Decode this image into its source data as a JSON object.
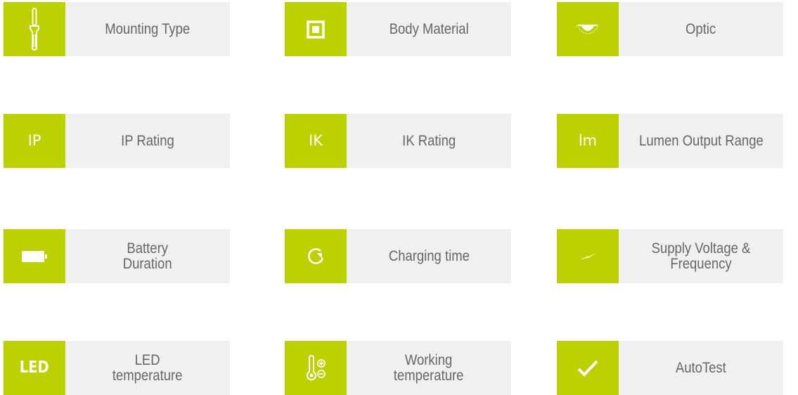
{
  "accent_color": "#bdd000",
  "label_bg_color": "#f0f0f0",
  "label_text_color": "#666666",
  "tiles": [
    {
      "id": "mounting-type",
      "icon": "screwdriver-icon",
      "icon_text": "",
      "label": "Mounting Type"
    },
    {
      "id": "body-material",
      "icon": "square-frame-icon",
      "icon_text": "",
      "label": "Body Material"
    },
    {
      "id": "optic",
      "icon": "optic-lens-icon",
      "icon_text": "",
      "label": "Optic"
    },
    {
      "id": "ip-rating",
      "icon": "ip-text-icon",
      "icon_text": "IP",
      "label": "IP Rating"
    },
    {
      "id": "ik-rating",
      "icon": "ik-text-icon",
      "icon_text": "IK",
      "label": "IK Rating"
    },
    {
      "id": "lumen-output-range",
      "icon": "lm-text-icon",
      "icon_text": "lm",
      "label": "Lumen Output Range"
    },
    {
      "id": "battery-duration",
      "icon": "battery-icon",
      "icon_text": "",
      "label": "Battery\nDuration"
    },
    {
      "id": "charging-time",
      "icon": "charging-clock-icon",
      "icon_text": "",
      "label": "Charging time"
    },
    {
      "id": "supply-voltage-frequency",
      "icon": "lightning-icon",
      "icon_text": "",
      "label": "Supply Voltage &\nFrequency"
    },
    {
      "id": "led-temperature",
      "icon": "led-text-icon",
      "icon_text": "LED",
      "label": "LED\ntemperature"
    },
    {
      "id": "working-temperature",
      "icon": "thermometer-plus-minus-icon",
      "icon_text": "",
      "label": "Working\ntemperature"
    },
    {
      "id": "autotest",
      "icon": "checkmark-icon",
      "icon_text": "",
      "label": "AutoTest"
    }
  ]
}
